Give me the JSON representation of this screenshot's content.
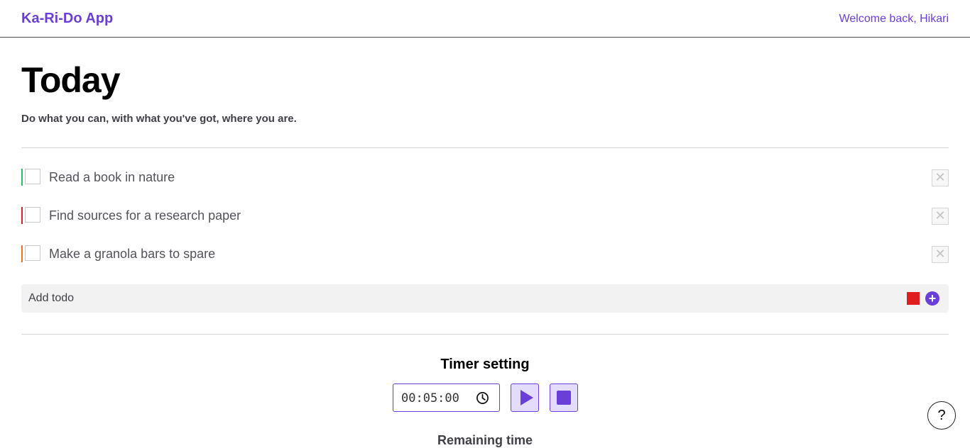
{
  "header": {
    "app_title": "Ka-Ri-Do App",
    "welcome": "Welcome back, Hikari"
  },
  "main": {
    "title": "Today",
    "subtitle": "Do what you can, with what you've got, where you are."
  },
  "todos": [
    {
      "text": "Read a book in nature",
      "color": "#22c55e",
      "done": false,
      "delete_icon": "close-icon"
    },
    {
      "text": "Find sources for a research paper",
      "color": "#dc2626",
      "done": false,
      "delete_icon": "close-icon"
    },
    {
      "text": "Make a granola bars to spare",
      "color": "#f97316",
      "done": false,
      "delete_icon": "close-icon"
    }
  ],
  "add_todo": {
    "placeholder": "Add todo",
    "selected_color": "#e11d1d",
    "add_icon": "plus-circle-icon"
  },
  "timer": {
    "title": "Timer setting",
    "value": "00:05:00",
    "clock_icon": "clock-icon",
    "play_icon": "play-icon",
    "stop_icon": "stop-icon",
    "remaining_label": "Remaining time"
  },
  "help": {
    "label": "?"
  },
  "colors": {
    "accent": "#6a3fd8",
    "button_bg": "#e3dcfa"
  }
}
